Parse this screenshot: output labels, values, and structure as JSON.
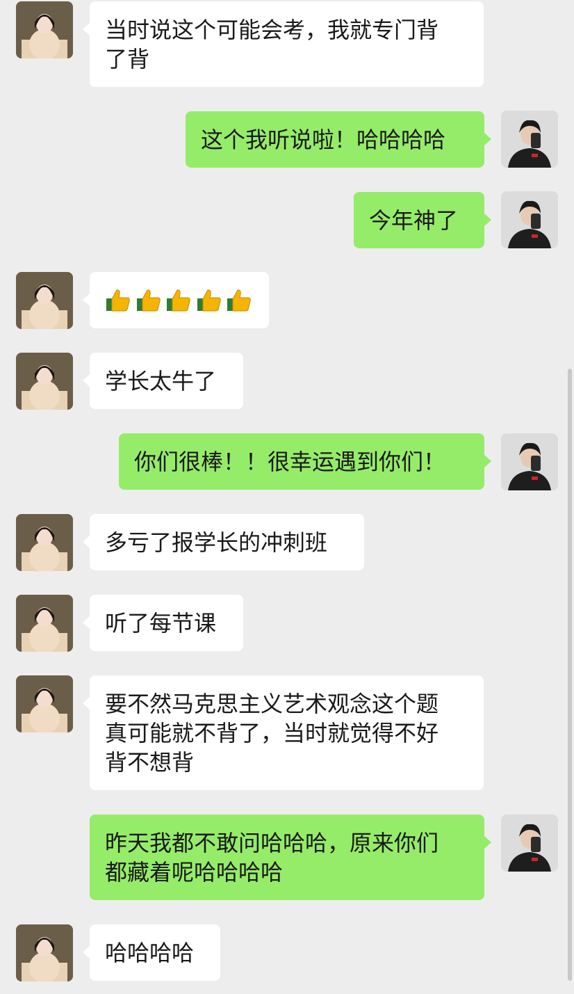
{
  "messages": [
    {
      "side": "in",
      "text": "当时说这个可能会考，我就专门背\n了背"
    },
    {
      "side": "out",
      "text": "这个我听说啦！哈哈哈哈"
    },
    {
      "side": "out",
      "text": "今年神了"
    },
    {
      "side": "in",
      "emoji": [
        "thumbs-up",
        "thumbs-up",
        "thumbs-up",
        "thumbs-up",
        "thumbs-up"
      ]
    },
    {
      "side": "in",
      "text": "学长太牛了"
    },
    {
      "side": "out",
      "text": "你们很棒！！很幸运遇到你们！"
    },
    {
      "side": "in",
      "text": "多亏了报学长的冲刺班"
    },
    {
      "side": "in",
      "text": "听了每节课"
    },
    {
      "side": "in",
      "text": "要不然马克思主义艺术观念这个题\n真可能就不背了，当时就觉得不好\n背不想背"
    },
    {
      "side": "out",
      "text": "昨天我都不敢问哈哈哈，原来你们\n都藏着呢哈哈哈哈"
    },
    {
      "side": "in",
      "text": "哈哈哈哈"
    }
  ],
  "colors": {
    "background": "#ededed",
    "incoming_bubble": "#ffffff",
    "outgoing_bubble": "#95ec69",
    "text": "#191919"
  },
  "icons": {
    "incoming_avatar": "woman-portrait-avatar",
    "outgoing_avatar": "man-portrait-avatar",
    "emoji": "thumbs-up-icon"
  }
}
